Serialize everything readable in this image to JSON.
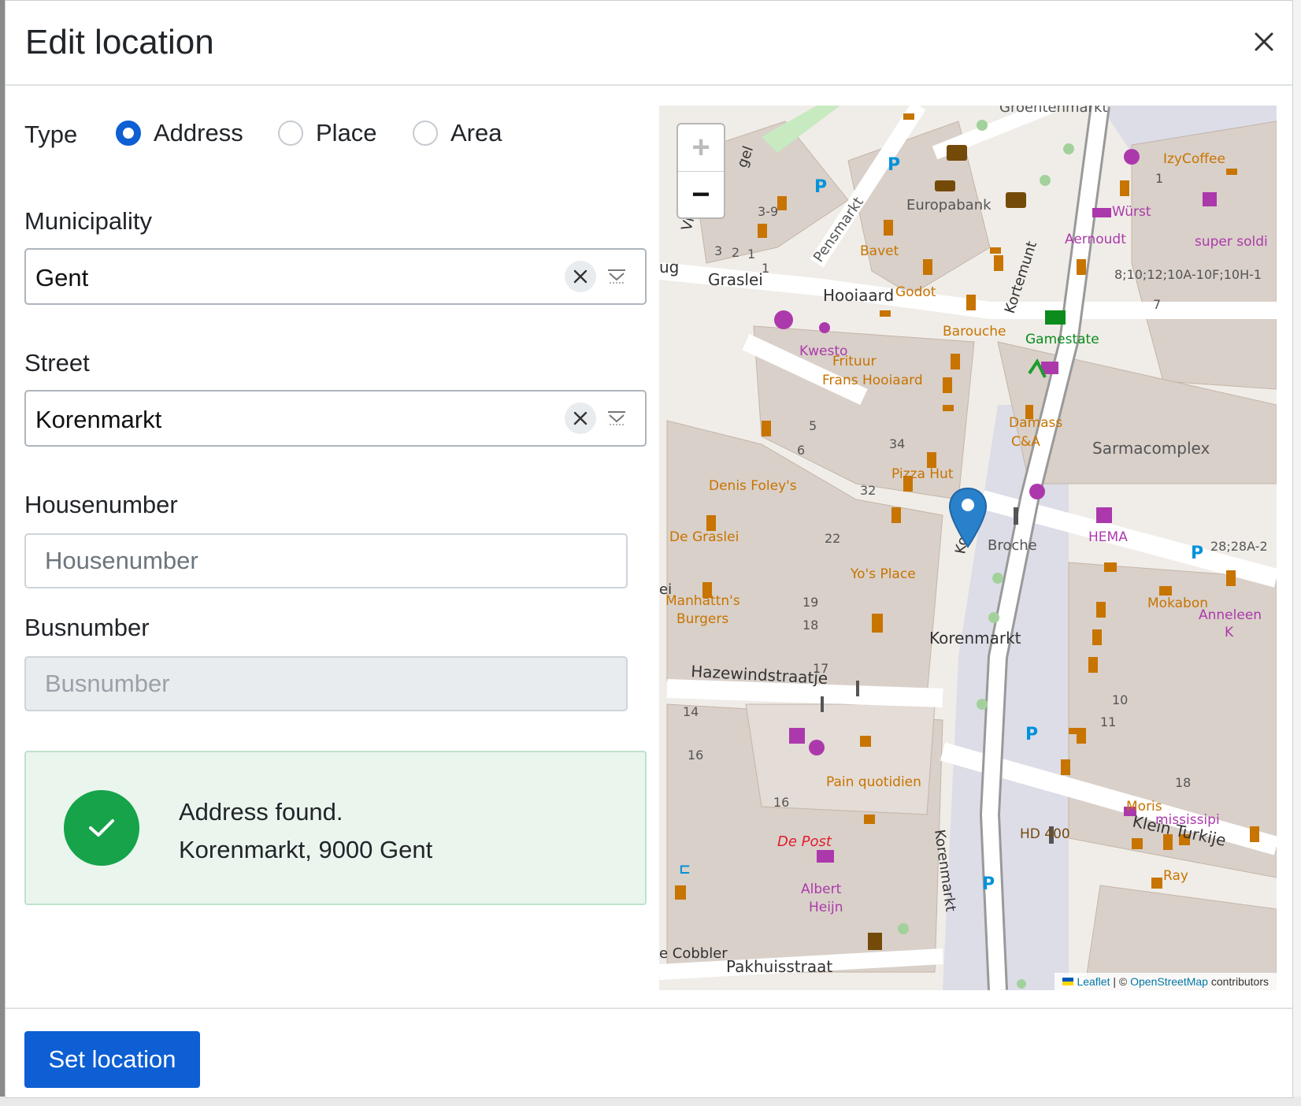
{
  "dialog": {
    "title": "Edit location"
  },
  "type": {
    "label": "Type",
    "options": [
      {
        "label": "Address",
        "checked": true
      },
      {
        "label": "Place",
        "checked": false
      },
      {
        "label": "Area",
        "checked": false
      }
    ]
  },
  "municipality": {
    "label": "Municipality",
    "value": "Gent"
  },
  "street": {
    "label": "Street",
    "value": "Korenmarkt"
  },
  "housenumber": {
    "label": "Housenumber",
    "placeholder": "Housenumber"
  },
  "busnumber": {
    "label": "Busnumber",
    "placeholder": "Busnumber"
  },
  "alert": {
    "line1": "Address found.",
    "line2": "Korenmarkt, 9000 Gent",
    "color": "#16a34a"
  },
  "map": {
    "zoom_in": "+",
    "zoom_out": "−",
    "attribution": {
      "leaflet": "Leaflet",
      "separator": " | © ",
      "osm": "OpenStreetMap",
      "suffix": " contributors"
    },
    "labels": {
      "groentenmarkt": "Groentenmarkt",
      "izycoffee": "IzyCoffee",
      "wurst": "Würst",
      "europabank": "Europabank",
      "pensmarkt": "Pensmarkt",
      "n39": "3-9",
      "n3": "3",
      "n2": "2",
      "n1a": "1",
      "n1b": "1",
      "bavet": "Bavet",
      "godot": "Godot",
      "aernoudt": "Aernoudt",
      "super_soldi": "super soldi",
      "addr_range": "8;10;12;10A-10F;10H-1",
      "n7": "7",
      "n1c": "1",
      "graslei": "Graslei",
      "hooiaard": "Hooiaard",
      "korte_munt": "Kortemunt",
      "barouche": "Barouche",
      "gamestate": "Gamestate",
      "kwesto": "Kwesto",
      "frituur1": "Frituur",
      "frituur2": "Frans Hooiaard",
      "damass": "Damass",
      "ca": "C&A",
      "sarmacomplex": "Sarmacomplex",
      "n5": "5",
      "n6": "6",
      "n34": "34",
      "n32": "32",
      "n22": "22",
      "pizza_hut": "Pizza Hut",
      "denis_foley": "Denis Foley's",
      "de_graslei": "De Graslei",
      "hema": "HEMA",
      "n28": "28;28A-2",
      "broche": "Broche",
      "yos_place": "Yo's Place",
      "manhattn1": "Manhattn's",
      "manhattn2": "Burgers",
      "n19": "19",
      "n18a": "18",
      "n17": "17",
      "korenmarkt_square": "Korenmarkt",
      "mokabon": "Mokabon",
      "anneleen1": "Anneleen",
      "anneleen2": "K",
      "hazewind": "Hazewindstraatje",
      "n14": "14",
      "n16a": "16",
      "n16b": "16",
      "n10": "10",
      "n11": "11",
      "n18b": "18",
      "pain_quotidien": "Pain quotidien",
      "moris": "Moris",
      "mississipi": "mississipi",
      "klein_turkije": "Klein Turkije",
      "hd400": "HD 400",
      "ray": "Ray",
      "de_post": "De Post",
      "albert1": "Albert",
      "albert2": "Heijn",
      "cobbler": "e Cobbler",
      "pakhuisstraat": "Pakhuisstraat",
      "korenmarkt_street": "Korenmarkt",
      "kor_short": "Kor",
      "ug": "ug",
      "ei": "ei",
      "vi": "Vi",
      "gel": "gel"
    }
  },
  "footer": {
    "submit_label": "Set location"
  },
  "colors": {
    "primary": "#0d5fd3",
    "success": "#16a34a",
    "map_pin": "#2a81cb"
  }
}
